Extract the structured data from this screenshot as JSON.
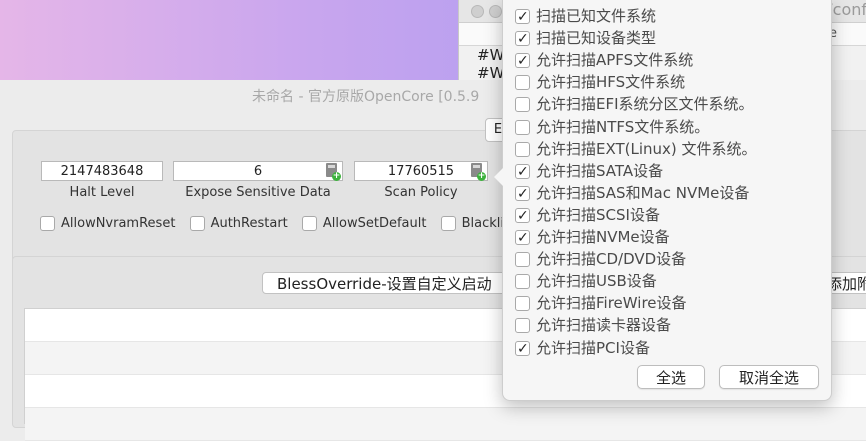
{
  "background_window": {
    "path_fragment": "/conf",
    "column_fragment": "e",
    "lines": [
      "#W",
      "#W"
    ]
  },
  "main_window": {
    "title": "未命名 - 官方原版OpenCore [0.5.9",
    "tab_fragment": "E",
    "fields": [
      {
        "value": "2147483648",
        "label": "Halt Level"
      },
      {
        "value": "6",
        "label": "Expose Sensitive Data"
      },
      {
        "value": "17760515",
        "label": "Scan Policy"
      }
    ],
    "checkboxes": [
      {
        "label": "AllowNvramReset",
        "checked": false
      },
      {
        "label": "AuthRestart",
        "checked": false
      },
      {
        "label": "AllowSetDefault",
        "checked": false
      },
      {
        "label": "Blacklis",
        "checked": false
      }
    ],
    "bless_button": "BlessOverride-设置自定义启动",
    "add_button": "添加附"
  },
  "popup": {
    "options": [
      {
        "label": "扫描已知文件系统",
        "checked": true
      },
      {
        "label": "扫描已知设备类型",
        "checked": true
      },
      {
        "label": "允许扫描APFS文件系统",
        "checked": true
      },
      {
        "label": "允许扫描HFS文件系统",
        "checked": false
      },
      {
        "label": "允许扫描EFI系统分区文件系统。",
        "checked": false
      },
      {
        "label": "允许扫描NTFS文件系统。",
        "checked": false
      },
      {
        "label": "允许扫描EXT(Linux) 文件系统。",
        "checked": false
      },
      {
        "label": "允许扫描SATA设备",
        "checked": true
      },
      {
        "label": "允许扫描SAS和Mac NVMe设备",
        "checked": true
      },
      {
        "label": "允许扫描SCSI设备",
        "checked": true
      },
      {
        "label": "允许扫描NVMe设备",
        "checked": true
      },
      {
        "label": "允许扫描CD/DVD设备",
        "checked": false
      },
      {
        "label": "允许扫描USB设备",
        "checked": false
      },
      {
        "label": "允许扫描FireWire设备",
        "checked": false
      },
      {
        "label": "允许扫描读卡器设备",
        "checked": false
      },
      {
        "label": "允许扫描PCI设备",
        "checked": true
      }
    ],
    "select_all": "全选",
    "deselect_all": "取消全选"
  }
}
